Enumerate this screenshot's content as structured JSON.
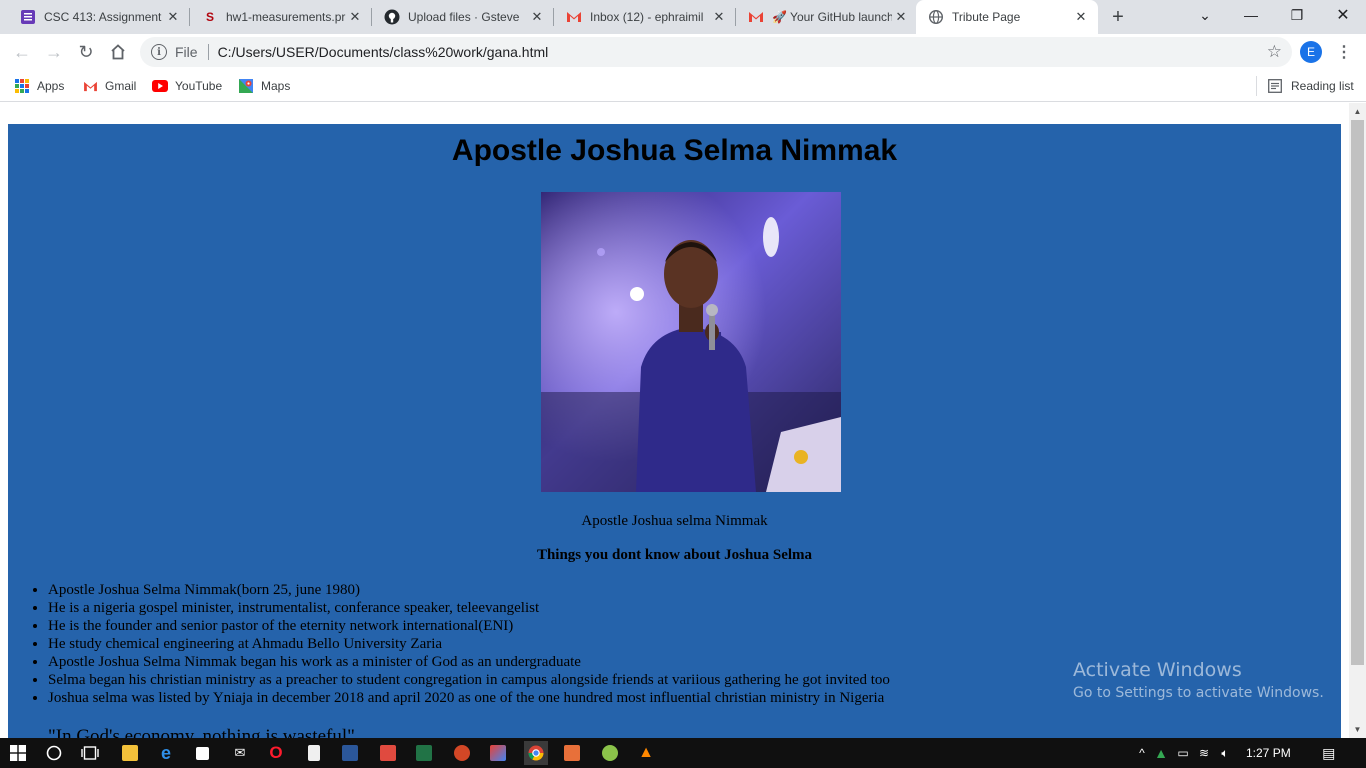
{
  "browser": {
    "tabs": [
      {
        "title": "CSC 413: Assignment",
        "icon": "form-icon",
        "color": "#673ab7"
      },
      {
        "title": "hw1-measurements.pr",
        "icon": "stanford-icon",
        "color": "#b1040e"
      },
      {
        "title": "Upload files · Gsteve",
        "icon": "github-icon",
        "color": "#24292e"
      },
      {
        "title": "Inbox (12) - ephraimil",
        "icon": "gmail-icon",
        "color": "#ea4335"
      },
      {
        "title": "🚀 Your GitHub launch",
        "icon": "gmail-icon",
        "color": "#ea4335"
      },
      {
        "title": "Tribute Page",
        "icon": "globe-icon",
        "color": "#5f6368",
        "active": true
      }
    ],
    "address": {
      "scheme": "File",
      "url": "C:/Users/USER/Documents/class%20work/gana.html"
    },
    "profile_initial": "E",
    "bookmarks": [
      {
        "label": "Apps",
        "icon": "apps-grid-icon"
      },
      {
        "label": "Gmail",
        "icon": "gmail-icon"
      },
      {
        "label": "YouTube",
        "icon": "youtube-icon"
      },
      {
        "label": "Maps",
        "icon": "maps-icon"
      }
    ],
    "reading_list": "Reading list"
  },
  "page": {
    "heading": "Apostle Joshua Selma Nimmak",
    "image_caption": "Apostle Joshua selma Nimmak",
    "subheading": "Things you dont know about Joshua Selma",
    "facts": [
      "Apostle Joshua Selma Nimmak(born 25, june 1980)",
      "He is a nigeria gospel minister, instrumentalist, conferance speaker, teleevangelist",
      "He is the founder and senior pastor of the eternity network international(ENI)",
      "He study chemical engineering at Ahmadu Bello University Zaria",
      "Apostle Joshua Selma Nimmak began his work as a minister of God as an undergraduate",
      "Selma began his christian ministry as a preacher to student congregation in campus alongside friends at variious gathering he got invited too",
      "Joshua selma was listed by Yniaja in december 2018 and april 2020 as one of the one hundred most influential christian ministry in Nigeria"
    ],
    "quote": "\"In God's economy, nothing is wasteful\"",
    "background_color": "#2563ab"
  },
  "watermark": {
    "line1": "Activate Windows",
    "line2": "Go to Settings to activate Windows."
  },
  "taskbar": {
    "time": "1:27 PM"
  }
}
